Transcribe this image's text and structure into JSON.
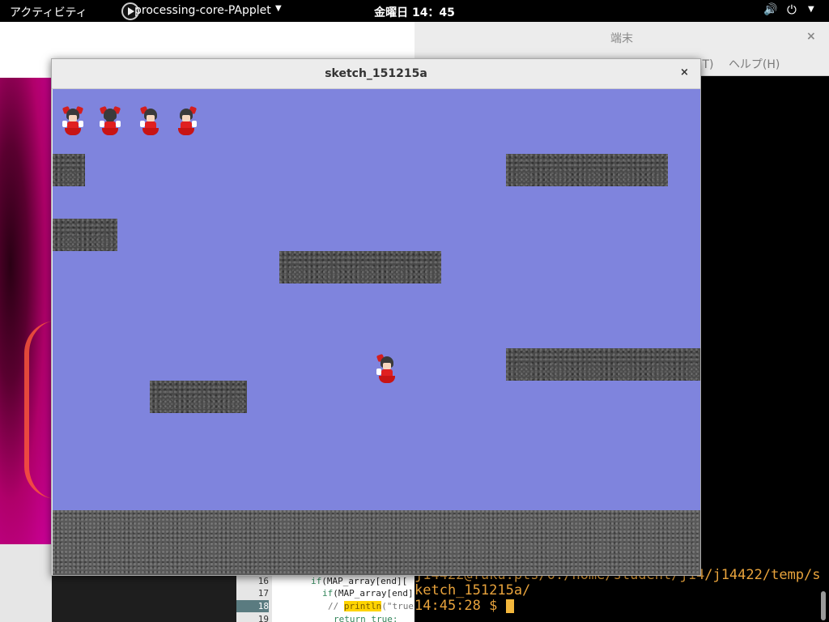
{
  "topbar": {
    "activities": "アクティビティ",
    "app_name": "processing-core-PApplet",
    "app_caret": "▼",
    "clock": "金曜日 14：45",
    "volume_icon": "🔊",
    "power_icon": "⏻",
    "system_caret": "▼"
  },
  "terminal": {
    "title": "端末",
    "close": "×",
    "menu": [
      "(T)",
      "ヘルプ(H)"
    ],
    "lines": [
      "j14422@fuku.pts/0:/home/student/j14/j14422/temp/s",
      "ketch_151215a/",
      "14:45:28 $ "
    ]
  },
  "editor": {
    "line_numbers": [
      "16",
      "17",
      "18",
      "19"
    ],
    "lines": {
      "l16_kw": "if",
      "l16_rest": "(MAP_array[end][",
      "l17_kw": "if",
      "l17_rest": "(MAP_array[end]",
      "l18_comment": "// ",
      "l18_hl": "println",
      "l18_rest": "(\"true",
      "l19": "return true;"
    }
  },
  "sketch": {
    "title": "sketch_151215a",
    "close": "×",
    "lives_count": 4,
    "colors": {
      "sky": "#7f84dd",
      "platform": "#4a4a4a",
      "ground": "#5a5a5a"
    }
  }
}
